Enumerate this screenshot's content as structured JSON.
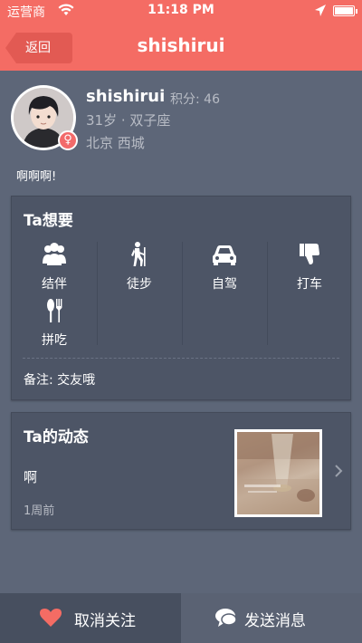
{
  "status": {
    "carrier": "运营商",
    "time": "11:18 PM"
  },
  "nav": {
    "back_label": "返回",
    "title": "shishirui"
  },
  "profile": {
    "name": "shishirui",
    "score": "积分: 46",
    "age_sign": "31岁 · 双子座",
    "location": "北京 西城",
    "gender_symbol": "♀",
    "bio": "啊啊啊!"
  },
  "wants": {
    "title": "Ta想要",
    "items": [
      {
        "label": "结伴",
        "icon": "group-icon"
      },
      {
        "label": "徒步",
        "icon": "hiking-icon"
      },
      {
        "label": "自驾",
        "icon": "car-icon"
      },
      {
        "label": "打车",
        "icon": "thumbs-down-icon"
      },
      {
        "label": "拼吃",
        "icon": "utensils-icon"
      }
    ],
    "note": "备注: 交友哦"
  },
  "feed": {
    "title": "Ta的动态",
    "text": "啊",
    "time": "1周前"
  },
  "bottom": {
    "unfollow_label": "取消关注",
    "message_label": "发送消息"
  },
  "colors": {
    "accent": "#f46c64",
    "background": "#5d6678",
    "card": "#4d5566"
  }
}
